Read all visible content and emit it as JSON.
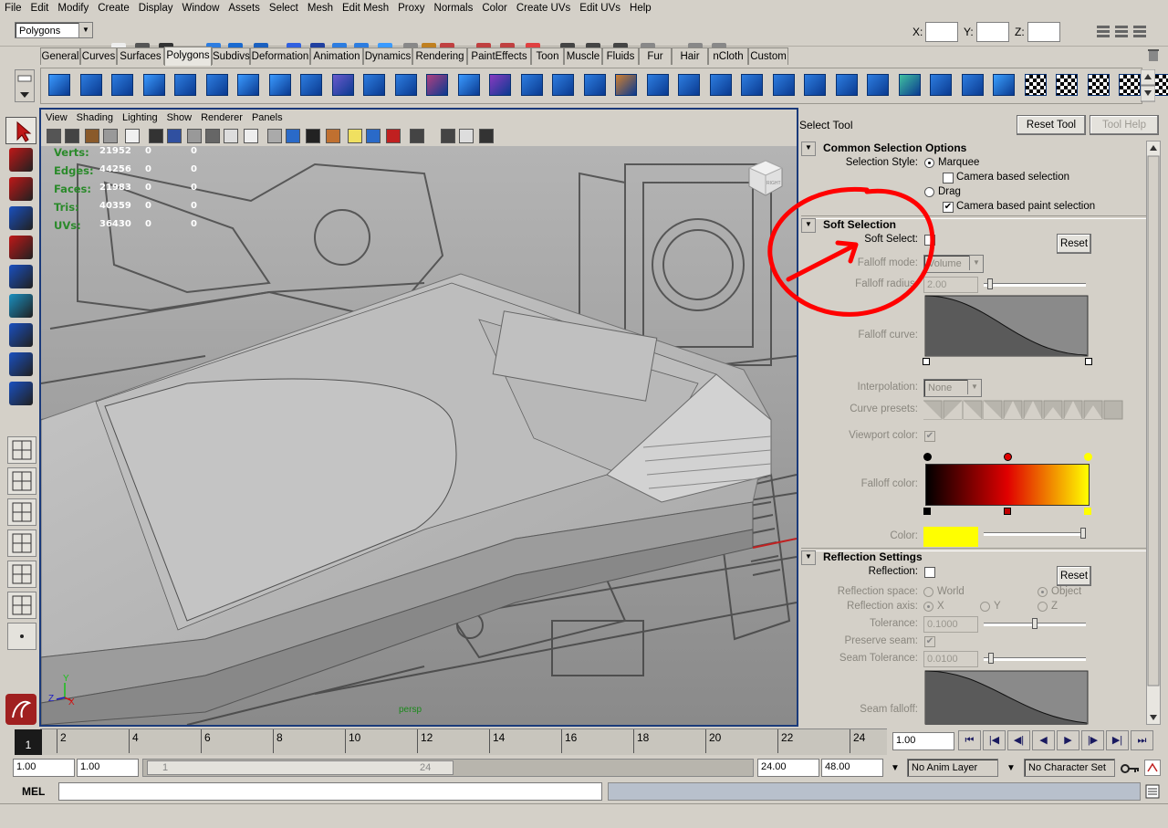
{
  "menubar": {
    "items": [
      "File",
      "Edit",
      "Modify",
      "Create",
      "Display",
      "Window",
      "Assets",
      "Select",
      "Mesh",
      "Edit Mesh",
      "Proxy",
      "Normals",
      "Color",
      "Create UVs",
      "Edit UVs",
      "Help"
    ]
  },
  "statusline": {
    "menu_set": "Polygons",
    "x_label": "X:",
    "y_label": "Y:",
    "z_label": "Z:"
  },
  "shelf": {
    "tabs": [
      "General",
      "Curves",
      "Surfaces",
      "Polygons",
      "Subdivs",
      "Deformation",
      "Animation",
      "Dynamics",
      "Rendering",
      "PaintEffects",
      "Toon",
      "Muscle",
      "Fluids",
      "Fur",
      "Hair",
      "nCloth",
      "Custom"
    ],
    "active_tab": "Polygons"
  },
  "viewport": {
    "menu": [
      "View",
      "Shading",
      "Lighting",
      "Show",
      "Renderer",
      "Panels"
    ],
    "camera_label": "persp",
    "view_cube_label": "RIGHT",
    "stats": [
      {
        "label": "Verts:",
        "v1": "21952",
        "v2": "0",
        "v3": "0"
      },
      {
        "label": "Edges:",
        "v1": "44256",
        "v2": "0",
        "v3": "0"
      },
      {
        "label": "Faces:",
        "v1": "21983",
        "v2": "0",
        "v3": "0"
      },
      {
        "label": "Tris:",
        "v1": "40359",
        "v2": "0",
        "v3": "0"
      },
      {
        "label": "UVs:",
        "v1": "36430",
        "v2": "0",
        "v3": "0"
      }
    ],
    "axis": {
      "y": "Y",
      "z": "Z",
      "x": "X"
    }
  },
  "tool_settings": {
    "title": "Select Tool",
    "reset_tool": "Reset Tool",
    "tool_help": "Tool Help",
    "common": {
      "header": "Common Selection Options",
      "selection_style_label": "Selection Style:",
      "marquee": "Marquee",
      "camera_based_selection": "Camera based selection",
      "drag": "Drag",
      "camera_based_paint": "Camera based paint selection"
    },
    "soft": {
      "header": "Soft Selection",
      "soft_select_label": "Soft Select:",
      "reset": "Reset",
      "falloff_mode_label": "Falloff mode:",
      "falloff_mode_value": "Volume",
      "falloff_radius_label": "Falloff radius:",
      "falloff_radius_value": "2.00",
      "falloff_curve_label": "Falloff curve:",
      "interpolation_label": "Interpolation:",
      "interpolation_value": "None",
      "curve_presets_label": "Curve presets:",
      "viewport_color_label": "Viewport color:",
      "falloff_color_label": "Falloff color:",
      "color_label": "Color:",
      "color_swatch": "#ffff00"
    },
    "reflection": {
      "header": "Reflection Settings",
      "reflection_label": "Reflection:",
      "reset": "Reset",
      "space_label": "Reflection space:",
      "world": "World",
      "object": "Object",
      "axis_label": "Reflection axis:",
      "x": "X",
      "y": "Y",
      "z": "Z",
      "tolerance_label": "Tolerance:",
      "tolerance_value": "0.1000",
      "preserve_seam_label": "Preserve seam:",
      "seam_tolerance_label": "Seam Tolerance:",
      "seam_tolerance_value": "0.0100",
      "seam_falloff_label": "Seam falloff:"
    }
  },
  "timeline": {
    "current_frame": "1",
    "ticks": [
      "2",
      "4",
      "6",
      "8",
      "10",
      "12",
      "14",
      "16",
      "18",
      "20",
      "22",
      "24"
    ],
    "current_time": "1.00",
    "range_start": "1.00",
    "playback_start": "1.00",
    "range_slider_start": "1",
    "range_slider_end": "24",
    "playback_end": "24.00",
    "range_end": "48.00",
    "anim_layer": "No Anim Layer",
    "character_set": "No Character Set"
  },
  "command_line": {
    "label": "MEL"
  },
  "colors": {
    "viewport_border": "#1a3a7a",
    "annotation": "#ff0000",
    "hud_label": "#2a8a2a"
  }
}
